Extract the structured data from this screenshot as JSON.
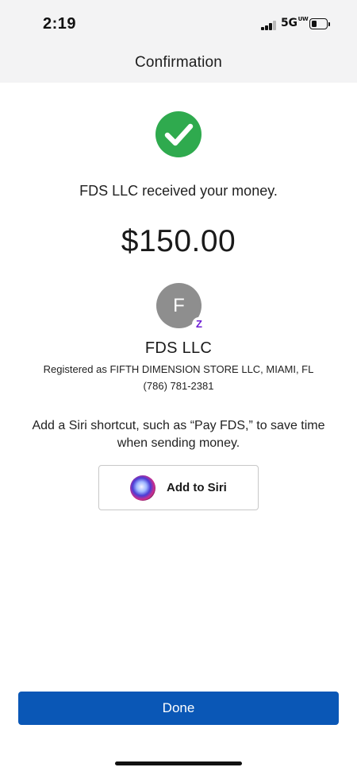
{
  "status_bar": {
    "time": "2:19",
    "network": "5G",
    "network_superscript": "UW"
  },
  "header": {
    "title": "Confirmation"
  },
  "confirmation": {
    "success_icon": "checkmark-circle-icon",
    "message": "FDS LLC received your money.",
    "amount": "$150.00"
  },
  "recipient": {
    "avatar_letter": "F",
    "badge_icon": "zelle-icon",
    "badge_text": "Z",
    "name": "FDS LLC",
    "registered": "Registered as FIFTH DIMENSION STORE LLC, MIAMI, FL",
    "phone": "(786) 781-2381"
  },
  "siri": {
    "description": "Add a Siri shortcut, such as “Pay FDS,” to save time when sending money.",
    "button_label": "Add to Siri",
    "icon": "siri-icon"
  },
  "footer": {
    "done_label": "Done"
  },
  "colors": {
    "success_green": "#2faa4e",
    "primary_blue": "#0a57b6",
    "zelle_purple": "#6d1ed4",
    "avatar_gray": "#8e8e8e",
    "header_bg": "#f3f3f4"
  }
}
